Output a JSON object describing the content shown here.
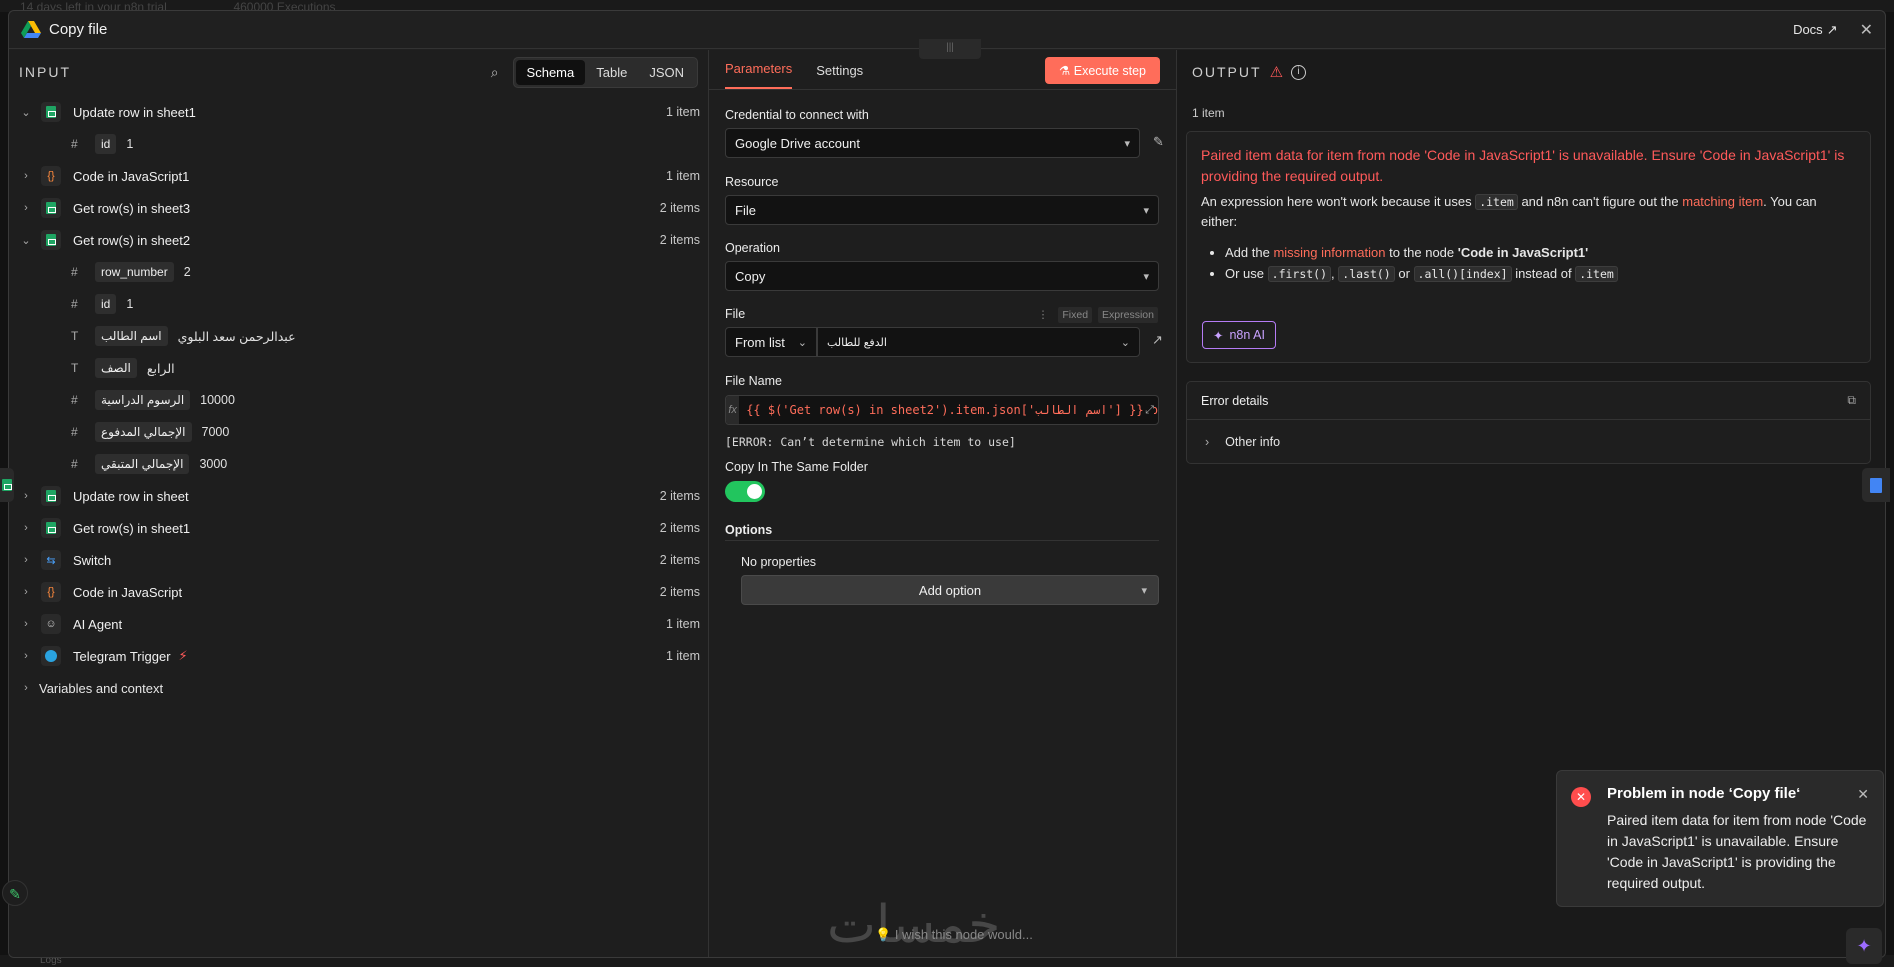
{
  "backdrop": {
    "trial_text": "14 days left in your n8n trial",
    "executions": "460000 Executions",
    "logs_label": "Logs"
  },
  "header": {
    "title": "Copy file",
    "docs_label": "Docs",
    "close_glyph": "✕"
  },
  "input": {
    "title": "INPUT",
    "view_tabs": [
      "Schema",
      "Table",
      "JSON"
    ],
    "active_view": "Schema",
    "nodes": [
      {
        "name": "Update row in sheet1",
        "count": "1 item",
        "icon": "sheets-icon",
        "expanded": true,
        "fields": [
          {
            "type": "#",
            "key": "id",
            "value": "1"
          }
        ]
      },
      {
        "name": "Code in JavaScript1",
        "count": "1 item",
        "icon": "code-icon",
        "expanded": false
      },
      {
        "name": "Get row(s) in sheet3",
        "count": "2 items",
        "icon": "sheets-icon",
        "expanded": false
      },
      {
        "name": "Get row(s) in sheet2",
        "count": "2 items",
        "icon": "sheets-icon",
        "expanded": true,
        "fields": [
          {
            "type": "#",
            "key": "row_number",
            "value": "2"
          },
          {
            "type": "#",
            "key": "id",
            "value": "1"
          },
          {
            "type": "T",
            "key": "اسم الطالب",
            "value": "عبدالرحمن سعد البلوي"
          },
          {
            "type": "T",
            "key": "الصف",
            "value": "الرابع"
          },
          {
            "type": "#",
            "key": "الرسوم الدراسية",
            "value": "10000"
          },
          {
            "type": "#",
            "key": "الإجمالي المدفوع",
            "value": "7000"
          },
          {
            "type": "#",
            "key": "الإجمالي المتبقي",
            "value": "3000"
          }
        ]
      },
      {
        "name": "Update row in sheet",
        "count": "2 items",
        "icon": "sheets-icon",
        "expanded": false
      },
      {
        "name": "Get row(s) in sheet1",
        "count": "2 items",
        "icon": "sheets-icon",
        "expanded": false
      },
      {
        "name": "Switch",
        "count": "2 items",
        "icon": "switch-icon",
        "expanded": false
      },
      {
        "name": "Code in JavaScript",
        "count": "2 items",
        "icon": "code-icon",
        "expanded": false
      },
      {
        "name": "AI Agent",
        "count": "1 item",
        "icon": "robot-icon",
        "expanded": false
      },
      {
        "name": "Telegram Trigger",
        "count": "1 item",
        "icon": "telegram-icon",
        "expanded": false
      }
    ],
    "variables_label": "Variables and context"
  },
  "params": {
    "tabs": [
      "Parameters",
      "Settings"
    ],
    "execute_label": "Execute step",
    "credential_label": "Credential to connect with",
    "credential_value": "Google Drive account",
    "resource_label": "Resource",
    "resource_value": "File",
    "operation_label": "Operation",
    "operation_value": "Copy",
    "file_label": "File",
    "fixed_label": "Fixed",
    "expression_label": "Expression",
    "file_mode": "From list",
    "file_value": "الدفع للطالب",
    "filename_label": "File Name",
    "filename_expr": "{{ $('Get row(s) in sheet2').item.json['اسم الطالب'] }}.p",
    "filename_error": "[ERROR: Can’t determine which item to use]",
    "same_folder_label": "Copy In The Same Folder",
    "same_folder_on": true,
    "options_label": "Options",
    "no_properties": "No properties",
    "add_option_label": "Add option",
    "wish_label": "I wish this node would..."
  },
  "output": {
    "title": "OUTPUT",
    "item_count": "1 item",
    "error_title": "Paired item data for item from node 'Code in JavaScript1' is unavailable. Ensure 'Code in JavaScript1' is providing the required output.",
    "desc_1": "An expression here won't work because it uses",
    "desc_chip": ".item",
    "desc_2": "and n8n can't figure out the",
    "desc_link": "matching item",
    "desc_3": ". You can either:",
    "bullet1_a": "Add the",
    "bullet1_link": "missing information",
    "bullet1_b": "to the node",
    "bullet1_node": "'Code in JavaScript1'",
    "bullet2_a": "Or use",
    "chip_first": ".first()",
    "chip_last": ".last()",
    "bullet2_or": "or",
    "chip_all": ".all()[index]",
    "bullet2_b": "instead of",
    "chip_item": ".item",
    "ai_label": "n8n AI",
    "details_label": "Error details",
    "other_info_label": "Other info"
  },
  "toast": {
    "title": "Problem in node ‘Copy file‘",
    "message": "Paired item data for item from node 'Code in JavaScript1' is unavailable. Ensure 'Code in JavaScript1' is providing the required output."
  },
  "watermark": "خمسات",
  "colors": {
    "accent": "#ff6d5a",
    "error": "#ff5a5a",
    "toggle_on": "#22c55e",
    "ai": "#b57cf5"
  }
}
